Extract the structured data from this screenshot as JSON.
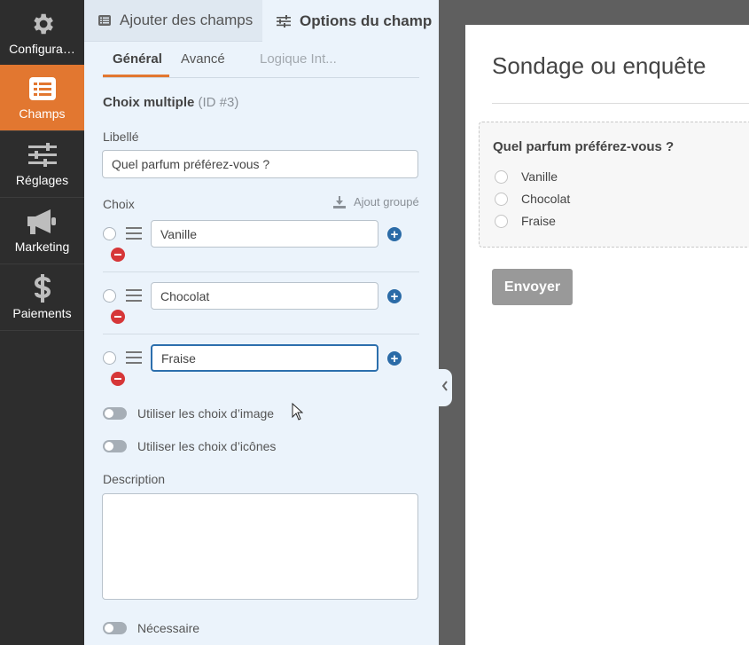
{
  "nav": {
    "items": [
      {
        "label": "Configura…",
        "icon": "gear-icon"
      },
      {
        "label": "Champs",
        "icon": "list-icon"
      },
      {
        "label": "Réglages",
        "icon": "sliders-icon"
      },
      {
        "label": "Marketing",
        "icon": "megaphone-icon"
      },
      {
        "label": "Paiements",
        "icon": "dollar-icon"
      }
    ],
    "active_color": "#e27730"
  },
  "panel": {
    "tabs": {
      "add_fields": "Ajouter des champs",
      "field_options": "Options du champ"
    },
    "subtabs": {
      "general": "Général",
      "advanced": "Avancé",
      "logic": "Logique Int..."
    },
    "field_title": "Choix multiple",
    "field_id": "(ID #3)",
    "label_caption": "Libellé",
    "label_value": "Quel parfum préférez-vous ?",
    "choices_caption": "Choix",
    "bulk_add": "Ajout groupé",
    "choices": [
      "Vanille",
      "Chocolat",
      "Fraise"
    ],
    "toggle_image": "Utiliser les choix d’image",
    "toggle_icons": "Utiliser les choix d’icônes",
    "description_caption": "Description",
    "required": "Nécessaire"
  },
  "preview": {
    "form_title": "Sondage ou enquête",
    "question": "Quel parfum préférez-vous ?",
    "options": [
      "Vanille",
      "Chocolat",
      "Fraise"
    ],
    "submit": "Envoyer"
  }
}
